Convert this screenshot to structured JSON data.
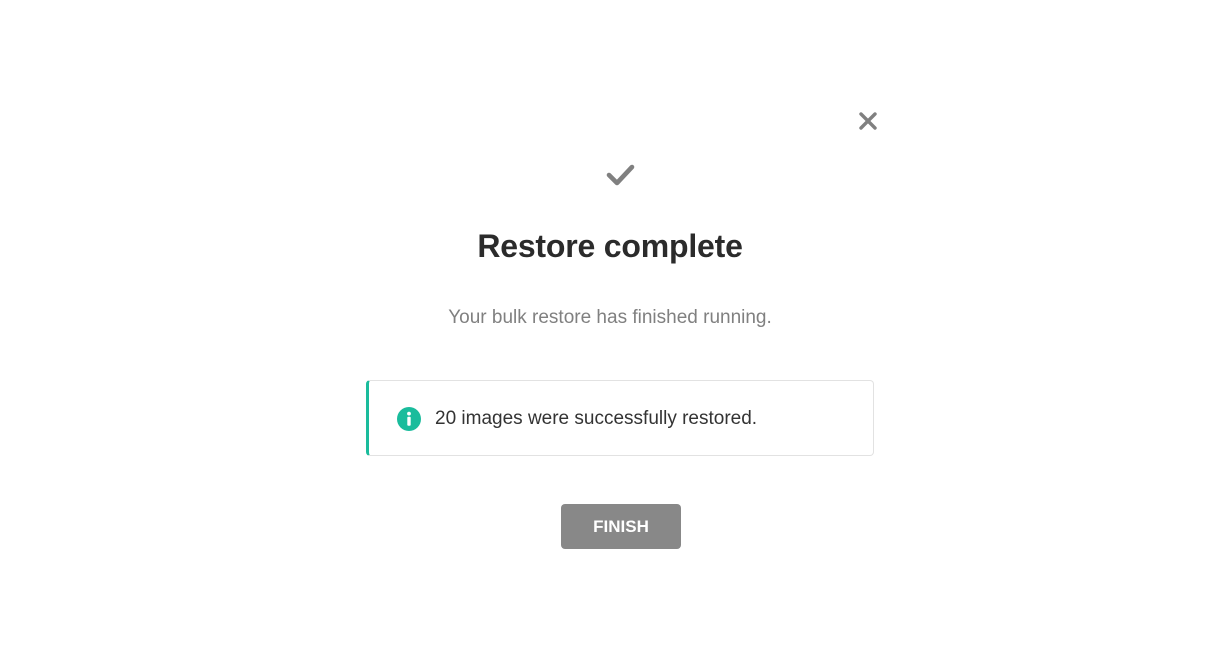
{
  "dialog": {
    "title": "Restore complete",
    "subtitle": "Your bulk restore has finished running.",
    "close_icon": "close-icon",
    "status_icon": "checkmark-icon"
  },
  "notice": {
    "icon": "info-icon",
    "message": "20 images were successfully restored.",
    "accent_color": "#1abc9c"
  },
  "actions": {
    "finish_label": "FINISH",
    "finish_color": "#888888"
  }
}
